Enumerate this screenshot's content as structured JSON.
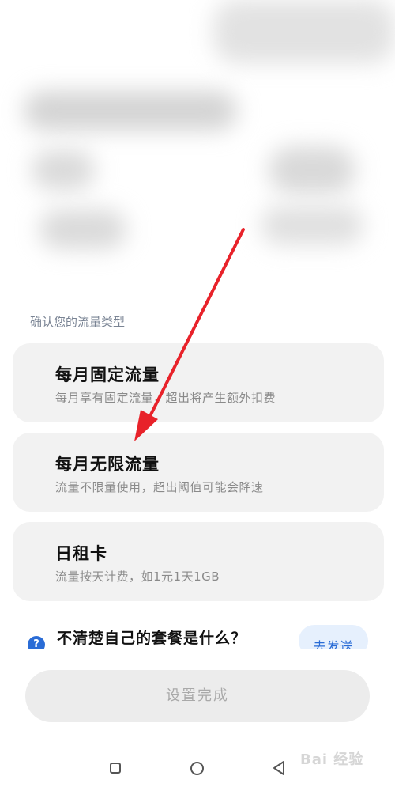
{
  "section": {
    "label": "确认您的流量类型"
  },
  "plans": [
    {
      "title": "每月固定流量",
      "desc": "每月享有固定流量，超出将产生额外扣费"
    },
    {
      "title": "每月无限流量",
      "desc": "流量不限量使用，超出阈值可能会降速"
    },
    {
      "title": "日租卡",
      "desc": "流量按天计费，如1元1天1GB"
    }
  ],
  "help": {
    "icon": "?",
    "text": "不清楚自己的套餐是什么？",
    "send_label": "去发送"
  },
  "footer": {
    "done_label": "设置完成"
  },
  "watermark": {
    "text": "Bai 经验"
  },
  "colors": {
    "accent": "#2a6cd6",
    "arrow": "#e8222a",
    "card_bg": "#f2f2f2"
  }
}
